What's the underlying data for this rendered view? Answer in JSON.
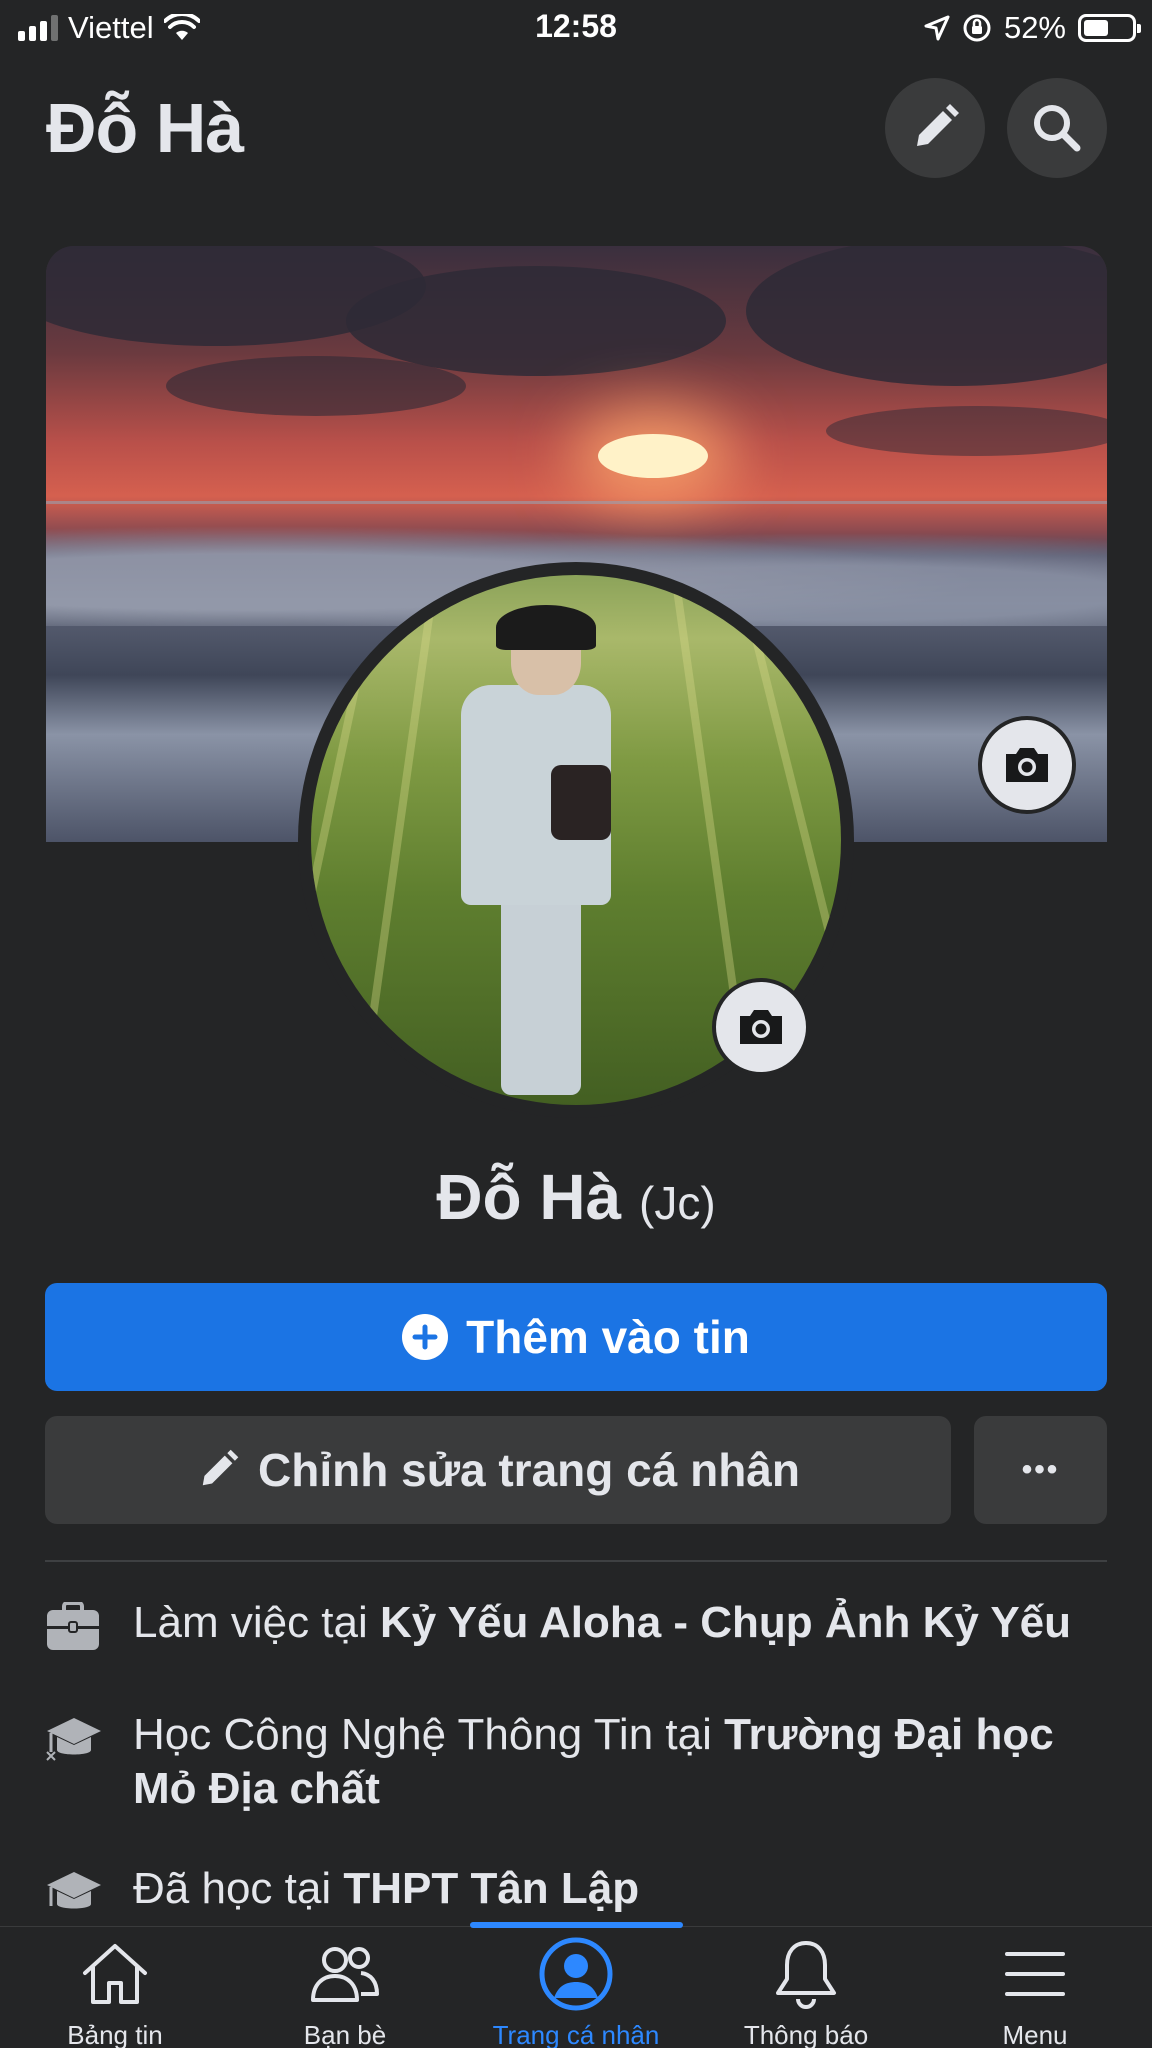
{
  "status_bar": {
    "carrier": "Viettel",
    "time": "12:58",
    "battery_percent": "52%",
    "battery_level": 0.52
  },
  "header": {
    "title": "Đỗ Hà"
  },
  "profile": {
    "name": "Đỗ Hà",
    "alternate_name": "(Jc)"
  },
  "actions": {
    "add_story_label": "Thêm vào tin",
    "edit_profile_label": "Chỉnh sửa trang cá nhân",
    "more_label": "•••"
  },
  "intro": [
    {
      "prefix": "Làm việc tại ",
      "value": "Kỷ Yếu Aloha - Chụp Ảnh Kỷ Yếu",
      "icon": "briefcase-icon"
    },
    {
      "prefix": "Học Công Nghệ Thông Tin tại ",
      "value": "Trường Đại học Mỏ Địa chất",
      "icon": "graduation-cap-icon"
    },
    {
      "prefix": "Đã học tại ",
      "value": "THPT Tân Lập",
      "icon": "graduation-cap-icon"
    }
  ],
  "bottom_nav": [
    {
      "label": "Bảng tin",
      "icon": "home-icon",
      "active": false
    },
    {
      "label": "Bạn bè",
      "icon": "friends-icon",
      "active": false
    },
    {
      "label": "Trang cá nhân",
      "icon": "profile-icon",
      "active": true
    },
    {
      "label": "Thông báo",
      "icon": "bell-icon",
      "active": false
    },
    {
      "label": "Menu",
      "icon": "menu-icon",
      "active": false
    }
  ],
  "colors": {
    "background": "#242526",
    "primary_blue": "#1b74e4",
    "active_blue": "#2d88ff",
    "button_grey": "#3a3b3c",
    "text": "#e4e6eb"
  }
}
